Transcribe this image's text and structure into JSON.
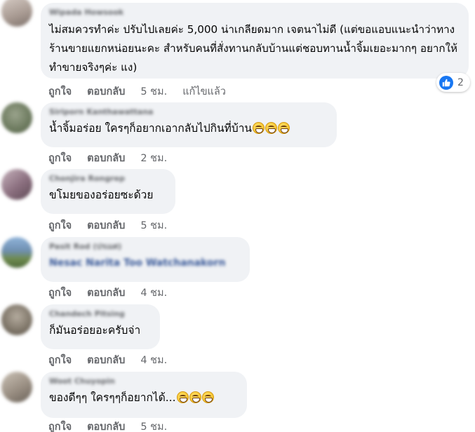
{
  "comments": [
    {
      "author": "Wipada Howsook",
      "text": "ไม่สมควรทำค่ะ ปรับไปเลยค่ะ 5,000 น่าเกลียดมาก เจตนาไม่ดี (แต่ขอแอบแนะนำว่าทางร้านขายแยกหน่อยนะคะ สำหรับคนที่สั่งทานกลับบ้านแต่ชอบทานน้ำจิ้มเยอะมากๆ อยากให้ทำขายจริงๆค่ะ แง)",
      "like": "ถูกใจ",
      "reply": "ตอบกลับ",
      "time": "5 ชม.",
      "edited": "แก้ไขแล้ว",
      "reaction_count": "2",
      "avatar_color": "#b9a9a0"
    },
    {
      "author": "Siriporn Kanthawattana",
      "text": "น้ำจิ้มอร่อย ใครๆก็อยากเอากลับไปกินที่บ้าน",
      "like": "ถูกใจ",
      "reply": "ตอบกลับ",
      "time": "2 ชม.",
      "emoji_count": 3,
      "avatar_color": "#7f8a74"
    },
    {
      "author": "Chonjira Rongrep",
      "text": "ขโมยของอร่อยซะด้วย",
      "like": "ถูกใจ",
      "reply": "ตอบกลับ",
      "time": "5 ชม.",
      "avatar_color": "#8b7c86"
    },
    {
      "author": "Pasit Rod (ปรเมศ)",
      "text": "Nesac Narita Too Watchanakorn",
      "like": "ถูกใจ",
      "reply": "ตอบกลับ",
      "time": "4 ชม.",
      "avatar_color": "#6f8fb0"
    },
    {
      "author": "Chandech Pitsing",
      "text": "ก็มันอร่อยอะครับจ่า",
      "like": "ถูกใจ",
      "reply": "ตอบกลับ",
      "time": "4 ชม.",
      "avatar_color": "#8a8376"
    },
    {
      "author": "Woot Chuyopin",
      "text": "ของดีๆๆ ใครๆๆก็อยากได้...",
      "like": "ถูกใจ",
      "reply": "ตอบกลับ",
      "time": "5 ชม.",
      "emoji_count": 3,
      "avatar_color": "#9a8f83"
    }
  ],
  "colors": {
    "bubble_bg": "#f0f2f5",
    "secondary_text": "#65676b",
    "like_blue": "#1877f2"
  },
  "icons": {
    "reaction": "thumbs-up-icon",
    "emoji": "grinning-face-icon"
  }
}
